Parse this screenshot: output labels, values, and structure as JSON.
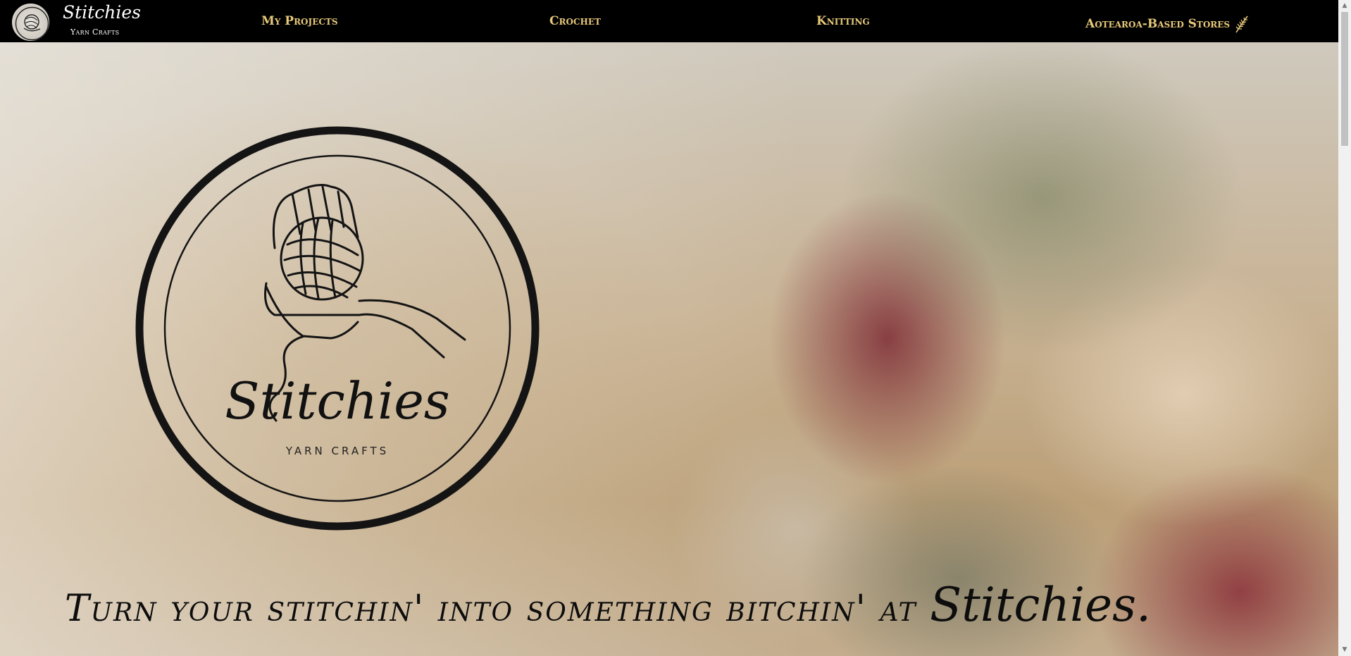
{
  "brand": {
    "name": "Stitchies",
    "subtitle": "Yarn Crafts"
  },
  "nav": {
    "items": [
      {
        "label": "My Projects"
      },
      {
        "label": "Crochet"
      },
      {
        "label": "Knitting"
      },
      {
        "label": "Aotearoa-Based Stores",
        "icon": "fern-icon"
      }
    ]
  },
  "hero": {
    "emblem_title": "Stitchies",
    "emblem_subtitle": "YARN CRAFTS",
    "emblem_icon": "hand-holding-yarn-icon",
    "tagline_prefix": "Turn your stitchin' into something bitchin' at ",
    "tagline_brand": "Stitchies."
  },
  "colors": {
    "nav_background": "#000000",
    "nav_link": "#e7c97b",
    "brand_text": "#ffffff",
    "emblem_ink": "#111111"
  }
}
